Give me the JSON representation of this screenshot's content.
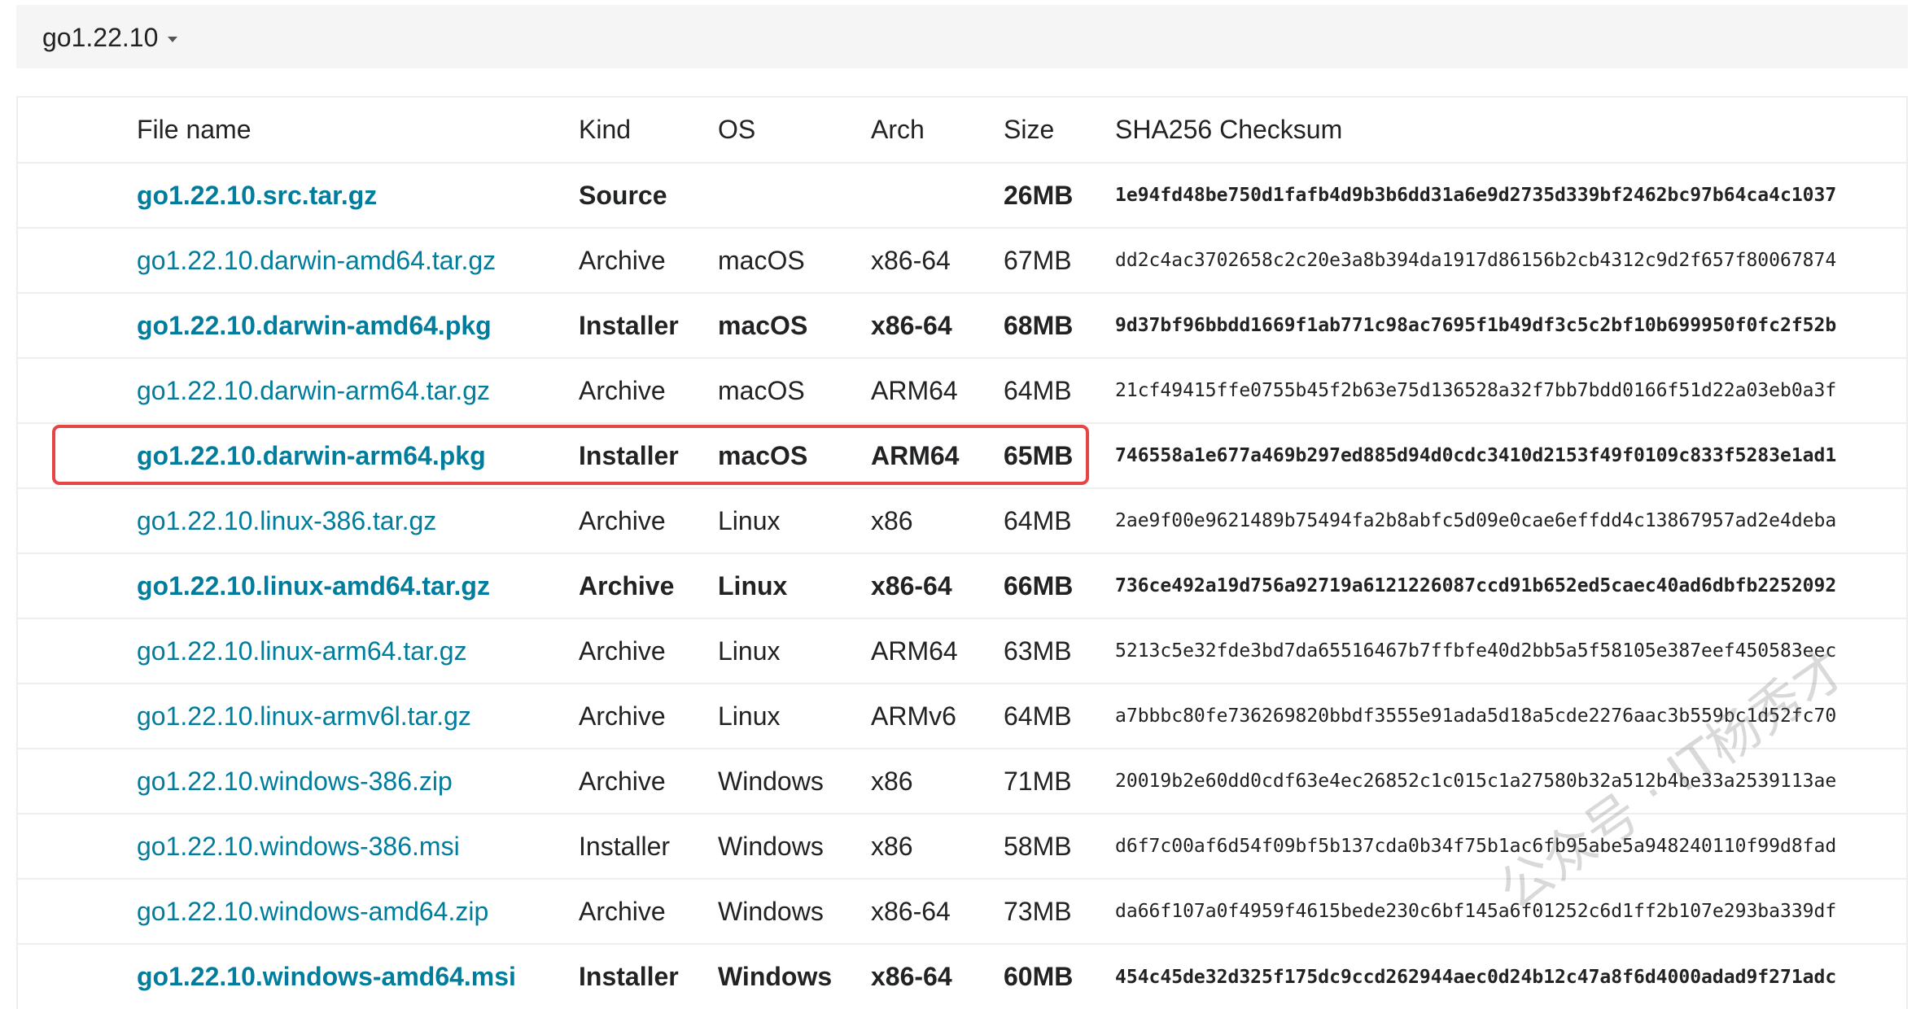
{
  "version_selector": {
    "label": "go1.22.10"
  },
  "table": {
    "headers": [
      "File name",
      "Kind",
      "OS",
      "Arch",
      "Size",
      "SHA256 Checksum"
    ],
    "rows": [
      {
        "file": "go1.22.10.src.tar.gz",
        "kind": "Source",
        "os": "",
        "arch": "",
        "size": "26MB",
        "sha": "1e94fd48be750d1fafb4d9b3b6dd31a6e9d2735d339bf2462bc97b64ca4c1037",
        "featured": true
      },
      {
        "file": "go1.22.10.darwin-amd64.tar.gz",
        "kind": "Archive",
        "os": "macOS",
        "arch": "x86-64",
        "size": "67MB",
        "sha": "dd2c4ac3702658c2c20e3a8b394da1917d86156b2cb4312c9d2f657f80067874",
        "featured": false
      },
      {
        "file": "go1.22.10.darwin-amd64.pkg",
        "kind": "Installer",
        "os": "macOS",
        "arch": "x86-64",
        "size": "68MB",
        "sha": "9d37bf96bbdd1669f1ab771c98ac7695f1b49df3c5c2bf10b699950f0fc2f52b",
        "featured": true
      },
      {
        "file": "go1.22.10.darwin-arm64.tar.gz",
        "kind": "Archive",
        "os": "macOS",
        "arch": "ARM64",
        "size": "64MB",
        "sha": "21cf49415ffe0755b45f2b63e75d136528a32f7bb7bdd0166f51d22a03eb0a3f",
        "featured": false
      },
      {
        "file": "go1.22.10.darwin-arm64.pkg",
        "kind": "Installer",
        "os": "macOS",
        "arch": "ARM64",
        "size": "65MB",
        "sha": "746558a1e677a469b297ed885d94d0cdc3410d2153f49f0109c833f5283e1ad1",
        "featured": true
      },
      {
        "file": "go1.22.10.linux-386.tar.gz",
        "kind": "Archive",
        "os": "Linux",
        "arch": "x86",
        "size": "64MB",
        "sha": "2ae9f00e9621489b75494fa2b8abfc5d09e0cae6effdd4c13867957ad2e4deba",
        "featured": false
      },
      {
        "file": "go1.22.10.linux-amd64.tar.gz",
        "kind": "Archive",
        "os": "Linux",
        "arch": "x86-64",
        "size": "66MB",
        "sha": "736ce492a19d756a92719a6121226087ccd91b652ed5caec40ad6dbfb2252092",
        "featured": true
      },
      {
        "file": "go1.22.10.linux-arm64.tar.gz",
        "kind": "Archive",
        "os": "Linux",
        "arch": "ARM64",
        "size": "63MB",
        "sha": "5213c5e32fde3bd7da65516467b7ffbfe40d2bb5a5f58105e387eef450583eec",
        "featured": false
      },
      {
        "file": "go1.22.10.linux-armv6l.tar.gz",
        "kind": "Archive",
        "os": "Linux",
        "arch": "ARMv6",
        "size": "64MB",
        "sha": "a7bbbc80fe736269820bbdf3555e91ada5d18a5cde2276aac3b559bc1d52fc70",
        "featured": false
      },
      {
        "file": "go1.22.10.windows-386.zip",
        "kind": "Archive",
        "os": "Windows",
        "arch": "x86",
        "size": "71MB",
        "sha": "20019b2e60dd0cdf63e4ec26852c1c015c1a27580b32a512b4be33a2539113ae",
        "featured": false
      },
      {
        "file": "go1.22.10.windows-386.msi",
        "kind": "Installer",
        "os": "Windows",
        "arch": "x86",
        "size": "58MB",
        "sha": "d6f7c00af6d54f09bf5b137cda0b34f75b1ac6fb95abe5a948240110f99d8fad",
        "featured": false
      },
      {
        "file": "go1.22.10.windows-amd64.zip",
        "kind": "Archive",
        "os": "Windows",
        "arch": "x86-64",
        "size": "73MB",
        "sha": "da66f107a0f4959f4615bede230c6bf145a6f01252c6d1ff2b107e293ba339df",
        "featured": false
      },
      {
        "file": "go1.22.10.windows-amd64.msi",
        "kind": "Installer",
        "os": "Windows",
        "arch": "x86-64",
        "size": "60MB",
        "sha": "454c45de32d325f175dc9ccd262944aec0d24b12c47a8f6d4000adad9f271adc",
        "featured": true
      }
    ]
  },
  "highlight": {
    "row_index": 4,
    "color": "#e64545"
  },
  "watermark": {
    "text": "公众号 · IT杨秀才"
  },
  "colors": {
    "link": "#007d9c",
    "header_bg": "#f5f5f5",
    "border": "#eeeeee"
  }
}
